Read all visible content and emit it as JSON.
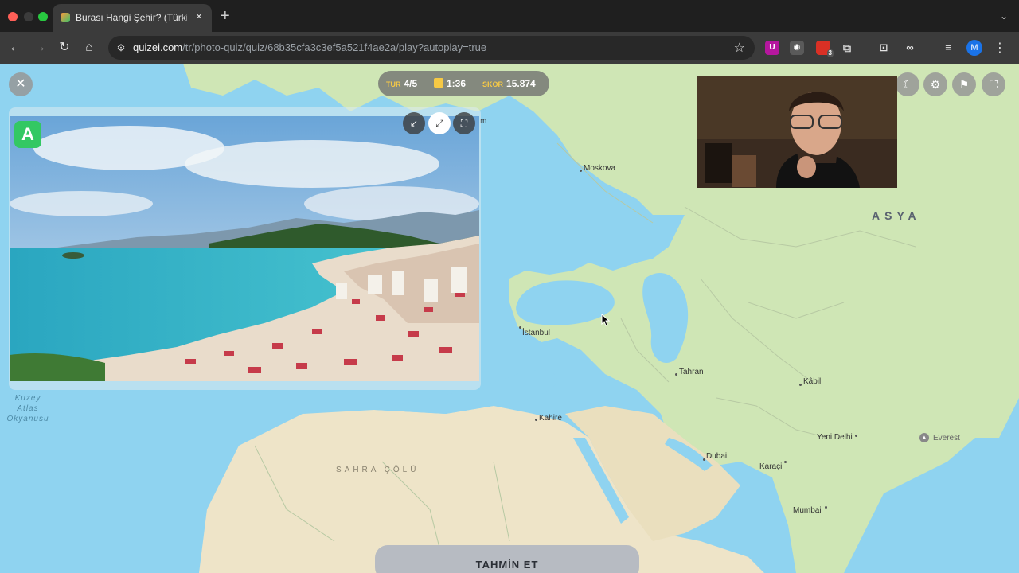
{
  "browser": {
    "tab_title": "Burası Hangi Şehir? (Türkiye)",
    "url_host": "quizei.com",
    "url_path": "/tr/photo-quiz/quiz/68b35cfa3c3ef5a521f4ae2a/play?autoplay=true",
    "profile_initial": "M",
    "extension_badge": "3"
  },
  "hud": {
    "round_label": "TUR",
    "round_value": "4/5",
    "timer_value": "1:36",
    "score_label": "SKOR",
    "score_value": "15.874"
  },
  "map": {
    "cities": [
      {
        "name": "Moskova"
      },
      {
        "name": "İstanbul"
      },
      {
        "name": "Tahran"
      },
      {
        "name": "Kâbil"
      },
      {
        "name": "Kahire"
      },
      {
        "name": "Yeni Delhi"
      },
      {
        "name": "Everest"
      },
      {
        "name": "Dubai"
      },
      {
        "name": "Karaçi"
      },
      {
        "name": "Mumbai"
      }
    ],
    "region_asia": "ASYA",
    "region_sahara": "SAHRA ÇÖLÜ",
    "ocean_line1": "Kuzey",
    "ocean_line2": "Atlas",
    "ocean_line3": "Okyanusu",
    "edge_fragment": "m"
  },
  "actions": {
    "guess_label": "TAHMİN ET"
  },
  "colors": {
    "water": "#8fd3f0",
    "land": "#cfe6b5",
    "desert": "#eee4c8",
    "hud_accent": "#f6c945",
    "brand_green": "#33c863"
  }
}
